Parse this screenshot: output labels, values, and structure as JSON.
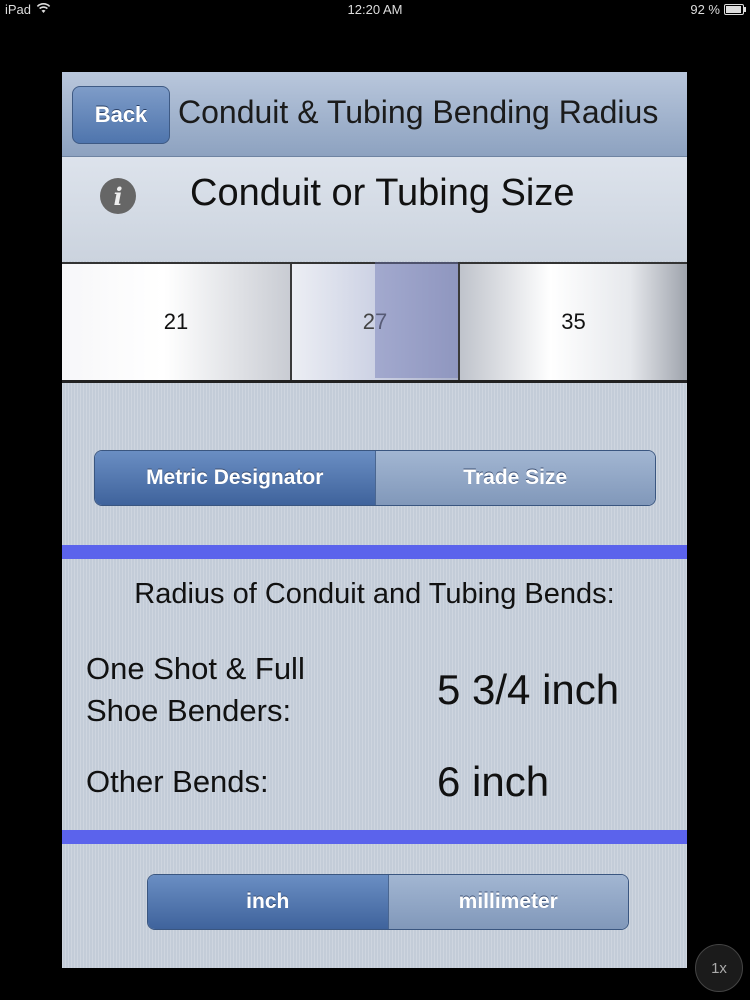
{
  "status_bar": {
    "device": "iPad",
    "time": "12:20 AM",
    "battery": "92 %",
    "battery_level": 0.92
  },
  "navbar": {
    "back_label": "Back",
    "title": "Conduit & Tubing Bending Radius"
  },
  "size_section": {
    "title": "Conduit or Tubing Size",
    "info_glyph": "i"
  },
  "picker": {
    "values": [
      "21",
      "27",
      "35"
    ],
    "selected": "27"
  },
  "designation_toggle": {
    "options": [
      "Metric Designator",
      "Trade Size"
    ],
    "selected": "Metric Designator"
  },
  "results": {
    "heading": "Radius of Conduit and Tubing Bends:",
    "one_shot_label_line1": "One Shot & Full",
    "one_shot_label_line2": "Shoe Benders:",
    "one_shot_value": "5 3/4 inch",
    "other_label": "Other Bends:",
    "other_value": "6 inch"
  },
  "unit_toggle": {
    "options": [
      "inch",
      "millimeter"
    ],
    "selected": "inch"
  },
  "zoom": {
    "label": "1x"
  },
  "colors": {
    "accent_rule": "#5b63ec",
    "segment_selected": "#4f75ad",
    "navbar": "#8da2c0"
  }
}
